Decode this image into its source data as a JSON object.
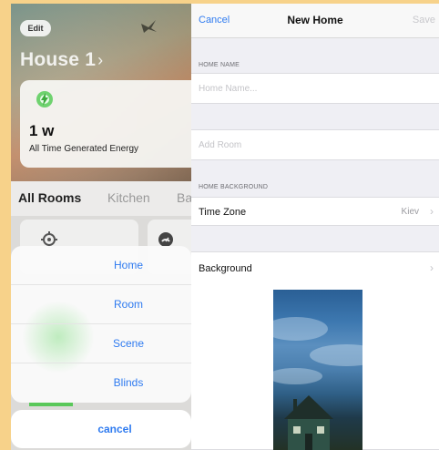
{
  "left": {
    "edit_label": "Edit",
    "house_title": "House 1",
    "house_title_chevron": "›",
    "energy": {
      "value": "1 w",
      "label": "All Time Generated Energy"
    },
    "rooms_tabs": [
      "All Rooms",
      "Kitchen",
      "Ba"
    ],
    "action_sheet": {
      "items": [
        "Home",
        "Room",
        "Scene",
        "Blinds"
      ],
      "cancel_label": "cancel"
    }
  },
  "right": {
    "nav": {
      "cancel": "Cancel",
      "title": "New Home",
      "save": "Save"
    },
    "home_name": {
      "header": "HOME NAME",
      "placeholder": "Home Name..."
    },
    "add_room": "Add Room",
    "home_background": {
      "header": "HOME BACKGROUND",
      "time_zone_label": "Time Zone",
      "time_zone_value": "Kiev",
      "background_label": "Background"
    },
    "chevron": "›"
  },
  "colors": {
    "accent_blue": "#2f7bf0",
    "frame_yellow": "#f7d28a",
    "energy_green": "#5ac85a"
  },
  "icons": {
    "bird": "bird-icon",
    "bolt": "bolt-icon",
    "gear": "gear-icon",
    "gauge": "gauge-icon"
  }
}
